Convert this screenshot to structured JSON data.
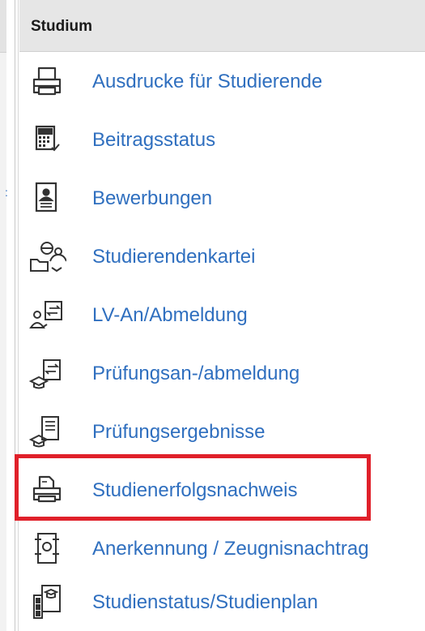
{
  "section": {
    "title": "Studium"
  },
  "left_marker": ":",
  "menu": {
    "items": [
      {
        "label": "Ausdrucke für Studierende",
        "icon": "printer-icon"
      },
      {
        "label": "Beitragsstatus",
        "icon": "calculator-check-icon"
      },
      {
        "label": "Bewerbungen",
        "icon": "person-document-icon"
      },
      {
        "label": "Studierendenkartei",
        "icon": "student-folder-icon"
      },
      {
        "label": "LV-An/Abmeldung",
        "icon": "person-exchange-icon"
      },
      {
        "label": "Prüfungsan-/abmeldung",
        "icon": "graduation-exchange-icon"
      },
      {
        "label": "Prüfungsergebnisse",
        "icon": "graduation-document-icon"
      },
      {
        "label": "Studienerfolgsnachweis",
        "icon": "printer-document-icon"
      },
      {
        "label": "Anerkennung / Zeugnisnachtrag",
        "icon": "certificate-document-icon"
      },
      {
        "label": "Studienstatus/Studienplan",
        "icon": "status-plan-icon"
      }
    ]
  },
  "highlight": {
    "color": "#e0202a",
    "item_label": "Studienerfolgsnachweis"
  },
  "colors": {
    "link": "#2f6fbf",
    "header_bg": "#e6e6e6",
    "icon_stroke": "#333333"
  }
}
